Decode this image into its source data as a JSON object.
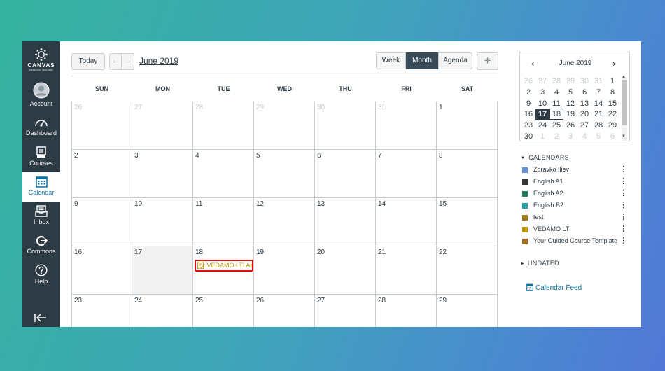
{
  "nav": {
    "brand": "CANVAS",
    "tagline": "FREE FOR TEACHER",
    "items": [
      {
        "label": "Account",
        "icon": "account-icon"
      },
      {
        "label": "Dashboard",
        "icon": "dashboard-icon"
      },
      {
        "label": "Courses",
        "icon": "courses-icon"
      },
      {
        "label": "Calendar",
        "icon": "calendar-icon",
        "active": true
      },
      {
        "label": "Inbox",
        "icon": "inbox-icon"
      },
      {
        "label": "Commons",
        "icon": "commons-icon"
      },
      {
        "label": "Help",
        "icon": "help-icon"
      }
    ]
  },
  "header": {
    "today_label": "Today",
    "prev_label": "←",
    "next_label": "→",
    "month_title": "June 2019",
    "views": [
      "Week",
      "Month",
      "Agenda"
    ],
    "active_view": "Month",
    "add_label": "+"
  },
  "grid": {
    "weekdays": [
      "SUN",
      "MON",
      "TUE",
      "WED",
      "THU",
      "FRI",
      "SAT"
    ],
    "weeks": [
      [
        {
          "d": "26",
          "o": true
        },
        {
          "d": "27",
          "o": true
        },
        {
          "d": "28",
          "o": true
        },
        {
          "d": "29",
          "o": true
        },
        {
          "d": "30",
          "o": true
        },
        {
          "d": "31",
          "o": true
        },
        {
          "d": "1"
        }
      ],
      [
        {
          "d": "2"
        },
        {
          "d": "3"
        },
        {
          "d": "4"
        },
        {
          "d": "5"
        },
        {
          "d": "6"
        },
        {
          "d": "7"
        },
        {
          "d": "8"
        }
      ],
      [
        {
          "d": "9"
        },
        {
          "d": "10"
        },
        {
          "d": "11"
        },
        {
          "d": "12"
        },
        {
          "d": "13"
        },
        {
          "d": "14"
        },
        {
          "d": "15"
        }
      ],
      [
        {
          "d": "16"
        },
        {
          "d": "17",
          "today": true
        },
        {
          "d": "18",
          "event": "VEDAMO LTI As"
        },
        {
          "d": "19"
        },
        {
          "d": "20"
        },
        {
          "d": "21"
        },
        {
          "d": "22"
        }
      ],
      [
        {
          "d": "23"
        },
        {
          "d": "24"
        },
        {
          "d": "25"
        },
        {
          "d": "26"
        },
        {
          "d": "27"
        },
        {
          "d": "28"
        },
        {
          "d": "29"
        }
      ]
    ]
  },
  "mini": {
    "title": "June 2019",
    "prev_label": "‹",
    "next_label": "›",
    "weeks": [
      [
        {
          "d": "26",
          "o": true
        },
        {
          "d": "27",
          "o": true
        },
        {
          "d": "28",
          "o": true
        },
        {
          "d": "29",
          "o": true
        },
        {
          "d": "30",
          "o": true
        },
        {
          "d": "31",
          "o": true
        },
        {
          "d": "1"
        }
      ],
      [
        {
          "d": "2"
        },
        {
          "d": "3"
        },
        {
          "d": "4"
        },
        {
          "d": "5"
        },
        {
          "d": "6"
        },
        {
          "d": "7"
        },
        {
          "d": "8"
        }
      ],
      [
        {
          "d": "9"
        },
        {
          "d": "10"
        },
        {
          "d": "11"
        },
        {
          "d": "12"
        },
        {
          "d": "13"
        },
        {
          "d": "14"
        },
        {
          "d": "15"
        }
      ],
      [
        {
          "d": "16"
        },
        {
          "d": "17",
          "today": true
        },
        {
          "d": "18",
          "sel": true
        },
        {
          "d": "19"
        },
        {
          "d": "20"
        },
        {
          "d": "21"
        },
        {
          "d": "22"
        }
      ],
      [
        {
          "d": "23"
        },
        {
          "d": "24"
        },
        {
          "d": "25"
        },
        {
          "d": "26"
        },
        {
          "d": "27"
        },
        {
          "d": "28"
        },
        {
          "d": "29"
        }
      ],
      [
        {
          "d": "30"
        },
        {
          "d": "1",
          "o": true
        },
        {
          "d": "2",
          "o": true
        },
        {
          "d": "3",
          "o": true
        },
        {
          "d": "4",
          "o": true
        },
        {
          "d": "5",
          "o": true
        },
        {
          "d": "6",
          "o": true
        }
      ]
    ]
  },
  "sidebar": {
    "calendars_header": "CALENDARS",
    "calendars": [
      {
        "name": "Zdravko Iliev",
        "color": "#5e8fd6"
      },
      {
        "name": "English A1",
        "color": "#3b3538"
      },
      {
        "name": "English A2",
        "color": "#217a5c"
      },
      {
        "name": "English B2",
        "color": "#2aa0a8"
      },
      {
        "name": "test",
        "color": "#a17a1f"
      },
      {
        "name": "VEDAMO LTI",
        "color": "#c29b0d"
      },
      {
        "name": "Your Guided Course Template",
        "color": "#a56b1e"
      }
    ],
    "kebab": "⋮",
    "undated_header": "UNDATED",
    "feed_label": "Calendar Feed"
  },
  "colors": {
    "nav_bg": "#2d3b45",
    "accent": "#0770a3",
    "event_text": "#c29b0d",
    "event_highlight": "#e01010"
  }
}
